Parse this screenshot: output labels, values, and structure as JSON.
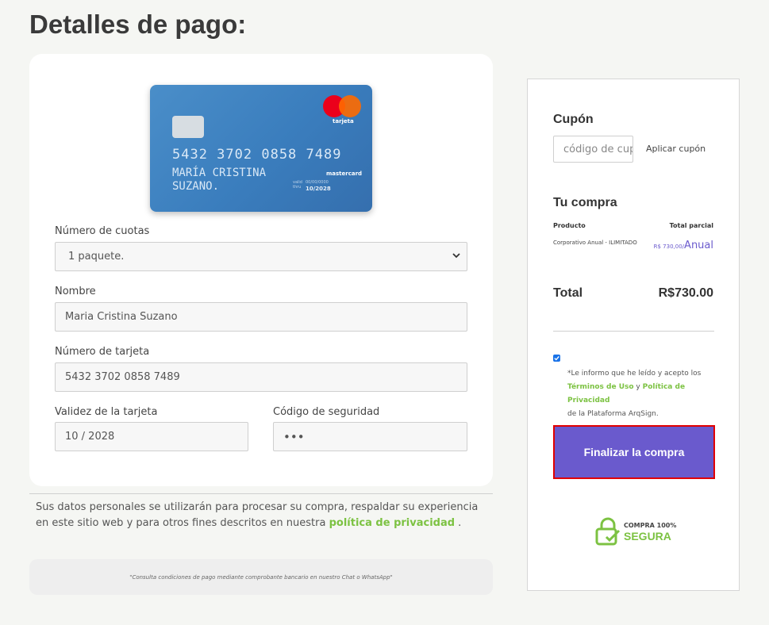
{
  "page": {
    "title": "Detalles de pago:"
  },
  "card": {
    "number": "5432 3702 0858 7489",
    "holder": "MARÍA CRISTINA SUZANO.",
    "brand_top": "tarjeta",
    "brand_bottom": "mastercard",
    "valid_label": "valid thru",
    "valid_small": "00/00/0000",
    "expiry": "10/2028"
  },
  "form": {
    "installments": {
      "label": "Número de cuotas",
      "value": "1 paquete."
    },
    "name": {
      "label": "Nombre",
      "value": "Maria Cristina Suzano"
    },
    "card_number": {
      "label": "Número de tarjeta",
      "value": "5432 3702 0858 7489"
    },
    "expiry": {
      "label": "Validez de la tarjeta",
      "value": "10 / 2028"
    },
    "cvc": {
      "label": "Código de seguridad",
      "value": "•••"
    }
  },
  "privacy": {
    "text": "Sus datos personales se utilizarán para procesar su compra, respaldar su experiencia en este sitio web y para otros fines descritos en nuestra ",
    "link": "política de privacidad",
    "suffix": " ."
  },
  "note": "\"Consulta condiciones de pago mediante comprobante bancario en nuestro Chat o WhatsApp\"",
  "summary": {
    "coupon_heading": "Cupón",
    "coupon_placeholder": "código de cupón",
    "coupon_button": "Aplicar cupón",
    "purchase_heading": "Tu compra",
    "col_product": "Producto",
    "col_subtotal": "Total parcial",
    "product_name": "Corporativo Anual - ILIMITADO",
    "product_amount": "R$ 730,00/",
    "product_period": "Anual",
    "total_label": "Total",
    "total_value": "R$730.00",
    "terms_prefix": "*Le informo que he leído y acepto los ",
    "terms_link1": "Términos de Uso",
    "terms_and": " y ",
    "terms_link2": "Política de Privacidad",
    "terms_suffix": "de la Plataforma ArqSign.",
    "terms_checked": true,
    "finalize_button": "Finalizar la compra",
    "secure_small": "COMPRA 100%",
    "secure_big": "SEGURA"
  },
  "colors": {
    "accent": "#6a5acd",
    "link": "#7cc242",
    "highlight": "#e00000"
  },
  "icons": [
    "mastercard-logo-icon",
    "chevron-down-icon",
    "checkbox-check-icon",
    "lock-check-icon"
  ]
}
